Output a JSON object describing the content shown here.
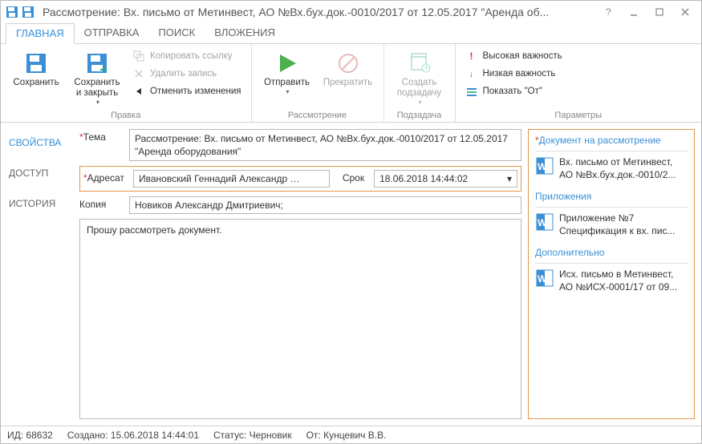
{
  "title": "Рассмотрение: Вх. письмо от Метинвест, АО №Вх.бух.док.-0010/2017 от 12.05.2017 \"Аренда об...",
  "tabs": {
    "main": "ГЛАВНАЯ",
    "send": "ОТПРАВКА",
    "search": "ПОИСК",
    "attach": "ВЛОЖЕНИЯ"
  },
  "ribbon": {
    "save": "Сохранить",
    "save_close": "Сохранить\nи закрыть",
    "copy_link": "Копировать ссылку",
    "delete": "Удалить запись",
    "undo": "Отменить изменения",
    "edit_group": "Правка",
    "send_btn": "Отправить",
    "stop": "Прекратить",
    "review_group": "Рассмотрение",
    "subtask": "Создать\nподзадачу",
    "subtask_group": "Подзадача",
    "hi": "Высокая важность",
    "lo": "Низкая важность",
    "show_from": "Показать \"От\"",
    "params_group": "Параметры"
  },
  "left": {
    "props": "СВОЙСТВА",
    "access": "ДОСТУП",
    "history": "ИСТОРИЯ"
  },
  "form": {
    "subject_lbl": "Тема",
    "subject_val": "Рассмотрение: Вх. письмо от Метинвест, АО №Вх.бух.док.-0010/2017 от 12.05.2017 \"Аренда оборудования\"",
    "addr_lbl": "Адресат",
    "addr_val": "Ивановский Геннадий Александр …",
    "deadline_lbl": "Срок",
    "deadline_val": "18.06.2018 14:44:02",
    "copy_lbl": "Копия",
    "copy_val": "Новиков Александр Дмитриевич;",
    "body": "Прошу рассмотреть документ."
  },
  "right": {
    "h1": "Документ на рассмотрение",
    "d1a": "Вх. письмо от Метинвест,",
    "d1b": "АО №Вх.бух.док.-0010/2...",
    "h2": "Приложения",
    "d2a": "Приложение №7",
    "d2b": "Спецификация к вх. пис...",
    "h3": "Дополнительно",
    "d3a": "Исх. письмо в Метинвест,",
    "d3b": "АО №ИСХ-0001/17 от 09..."
  },
  "status": {
    "id": "ИД: 68632",
    "created": "Создано: 15.06.2018 14:44:01",
    "state": "Статус: Черновик",
    "from": "От: Кунцевич В.В."
  }
}
